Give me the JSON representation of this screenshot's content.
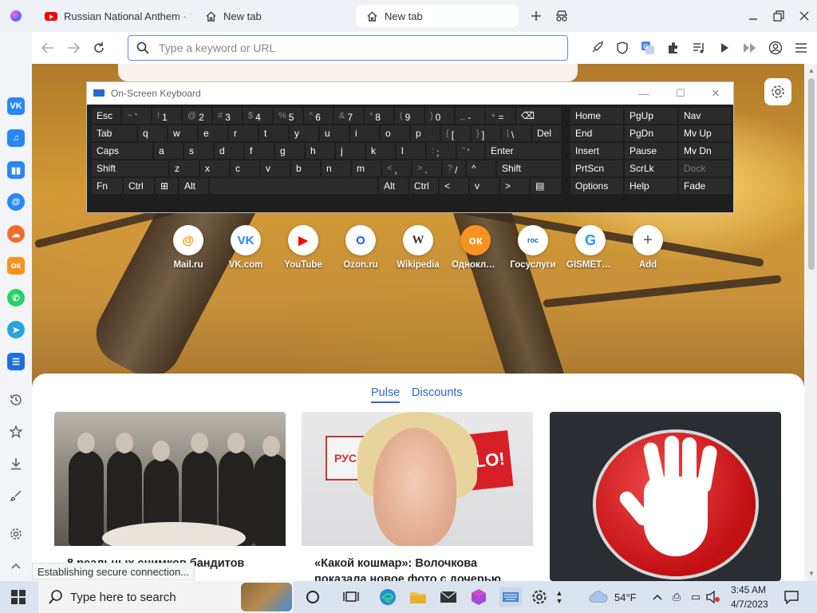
{
  "tabs": [
    {
      "title": "Russian National Anthem - \"G",
      "icon": "youtube-icon"
    },
    {
      "title": "New tab",
      "icon": "home-icon"
    },
    {
      "title": "New tab",
      "icon": "home-icon",
      "active": true
    }
  ],
  "omnibox": {
    "placeholder": "Type a keyword or URL",
    "value": ""
  },
  "keyboard": {
    "title": "On-Screen Keyboard",
    "rows": [
      [
        [
          "Esc",
          ""
        ],
        [
          "`",
          "~"
        ],
        [
          "1",
          "!"
        ],
        [
          "2",
          "@"
        ],
        [
          "3",
          "#"
        ],
        [
          "4",
          "$"
        ],
        [
          "5",
          "%"
        ],
        [
          "6",
          "^"
        ],
        [
          "7",
          "&"
        ],
        [
          "8",
          "*"
        ],
        [
          "9",
          "("
        ],
        [
          "0",
          ")"
        ],
        [
          "-",
          "_"
        ],
        [
          "=",
          "+"
        ],
        [
          "⌫",
          ""
        ]
      ],
      [
        [
          "Tab",
          ""
        ],
        [
          "q",
          ""
        ],
        [
          "w",
          ""
        ],
        [
          "e",
          ""
        ],
        [
          "r",
          ""
        ],
        [
          "t",
          ""
        ],
        [
          "y",
          ""
        ],
        [
          "u",
          ""
        ],
        [
          "i",
          ""
        ],
        [
          "o",
          ""
        ],
        [
          "p",
          ""
        ],
        [
          "[",
          "{"
        ],
        [
          "]",
          "}"
        ],
        [
          "\\",
          "|"
        ],
        [
          "Del",
          ""
        ]
      ],
      [
        [
          "Caps",
          ""
        ],
        [
          "a",
          ""
        ],
        [
          "s",
          ""
        ],
        [
          "d",
          ""
        ],
        [
          "f",
          ""
        ],
        [
          "g",
          ""
        ],
        [
          "h",
          ""
        ],
        [
          "j",
          ""
        ],
        [
          "k",
          ""
        ],
        [
          "l",
          ""
        ],
        [
          ";",
          ":"
        ],
        [
          "'",
          "\""
        ],
        [
          "Enter",
          ""
        ]
      ],
      [
        [
          "Shift",
          ""
        ],
        [
          "z",
          ""
        ],
        [
          "x",
          ""
        ],
        [
          "c",
          ""
        ],
        [
          "v",
          ""
        ],
        [
          "b",
          ""
        ],
        [
          "n",
          ""
        ],
        [
          "m",
          ""
        ],
        [
          ",",
          "<"
        ],
        [
          ".",
          ">"
        ],
        [
          "/",
          "?"
        ],
        [
          "^",
          ""
        ],
        [
          "Shift",
          ""
        ]
      ],
      [
        [
          "Fn",
          ""
        ],
        [
          "Ctrl",
          ""
        ],
        [
          "⊞",
          ""
        ],
        [
          "Alt",
          ""
        ],
        [
          "",
          ""
        ],
        [
          "Alt",
          ""
        ],
        [
          "Ctrl",
          ""
        ],
        [
          "<",
          ""
        ],
        [
          "v",
          ""
        ],
        [
          ">",
          ""
        ],
        [
          "▤",
          ""
        ]
      ]
    ],
    "nav": [
      [
        "Home",
        "PgUp",
        "Nav"
      ],
      [
        "End",
        "PgDn",
        "Mv Up"
      ],
      [
        "Insert",
        "Pause",
        "Mv Dn"
      ],
      [
        "PrtScn",
        "ScrLk",
        "Dock"
      ],
      [
        "Options",
        "Help",
        "Fade"
      ]
    ]
  },
  "speed_dial": [
    {
      "label": "Mail.ru",
      "glyph": "@",
      "color": "#ff8a00"
    },
    {
      "label": "VK.com",
      "glyph": "VK",
      "color": "#2787f5"
    },
    {
      "label": "YouTube",
      "glyph": "▶",
      "color": "#ff0000"
    },
    {
      "label": "Ozon.ru",
      "glyph": "O",
      "color": "#1e5cff"
    },
    {
      "label": "Wikipedia",
      "glyph": "W",
      "color": "#333333"
    },
    {
      "label": "Одноклассники",
      "glyph": "ок",
      "color": "#f7931e"
    },
    {
      "label": "Госуслуги",
      "glyph": "гос",
      "color": "#1b5fb0"
    },
    {
      "label": "GISMETEO",
      "glyph": "G",
      "color": "#1a9bff"
    },
    {
      "label": "Add",
      "glyph": "+",
      "color": "#555555"
    }
  ],
  "feed": {
    "tabs": [
      "Pulse",
      "Discounts"
    ],
    "cards": [
      {
        "title": "8 реальных снимков бандитов"
      },
      {
        "title": "«Какой кошмар»: Волочкова показала новое фото с дочерью"
      },
      {
        "title": ""
      }
    ],
    "hello_text": "HELLO!",
    "sign_text": "РУС"
  },
  "status": "Establishing secure connection...",
  "taskbar": {
    "search_placeholder": "Type here to search",
    "weather": "54°F",
    "time": "3:45 AM",
    "date": "4/7/2023"
  }
}
